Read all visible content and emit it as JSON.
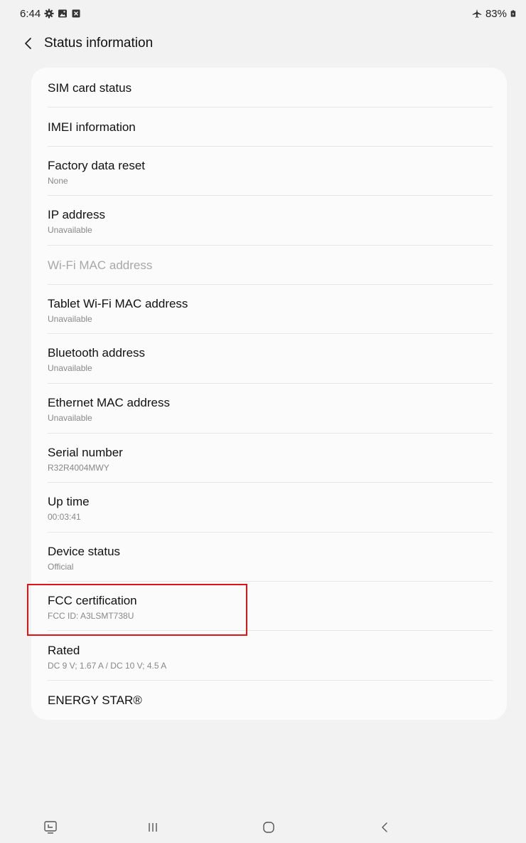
{
  "status_bar": {
    "time": "6:44",
    "battery": "83%",
    "icons_left": [
      "gear-icon",
      "gallery-icon",
      "close-box-icon"
    ],
    "icons_right": [
      "airplane-icon",
      "battery-icon"
    ]
  },
  "header": {
    "title": "Status information",
    "back_icon": "chevron-left-icon"
  },
  "items": [
    {
      "title": "SIM card status",
      "sub": ""
    },
    {
      "title": "IMEI information",
      "sub": ""
    },
    {
      "title": "Factory data reset",
      "sub": "None"
    },
    {
      "title": "IP address",
      "sub": "Unavailable"
    },
    {
      "title": "Wi-Fi MAC address",
      "sub": "",
      "disabled": true
    },
    {
      "title": "Tablet Wi-Fi MAC address",
      "sub": "Unavailable"
    },
    {
      "title": "Bluetooth address",
      "sub": "Unavailable"
    },
    {
      "title": "Ethernet MAC address",
      "sub": "Unavailable"
    },
    {
      "title": "Serial number",
      "sub": "R32R4004MWY"
    },
    {
      "title": "Up time",
      "sub": "00:03:41"
    },
    {
      "title": "Device status",
      "sub": "Official"
    },
    {
      "title": "FCC certification",
      "sub": "FCC ID: A3LSMT738U"
    },
    {
      "title": "Rated",
      "sub": "DC 9 V; 1.67 A / DC 10 V; 4.5 A"
    },
    {
      "title": "ENERGY STAR®",
      "sub": ""
    }
  ],
  "colors": {
    "background": "#f2f2f2",
    "card": "#fbfbfb",
    "highlight": "#e01414",
    "secondary_text": "#888888",
    "disabled_text": "#a8a8a8"
  },
  "nav_bar": {
    "icons": [
      "screenshot-icon",
      "recents-icon",
      "home-icon",
      "back-icon"
    ]
  }
}
